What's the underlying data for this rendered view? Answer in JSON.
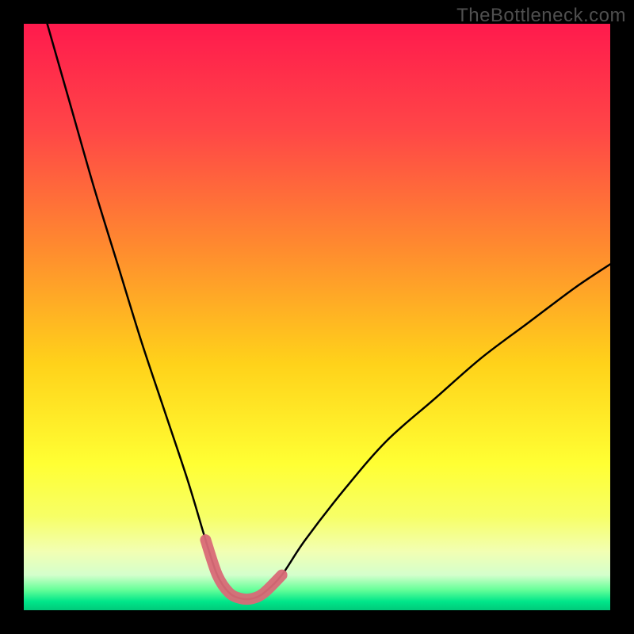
{
  "watermark": "TheBottleneck.com",
  "chart_data": {
    "type": "line",
    "title": "",
    "xlabel": "",
    "ylabel": "",
    "xlim": [
      0,
      100
    ],
    "ylim": [
      0,
      100
    ],
    "series": [
      {
        "name": "bottleneck-curve",
        "x": [
          4,
          8,
          12,
          16,
          20,
          24,
          28,
          31,
          33,
          35,
          37,
          39,
          41,
          44,
          48,
          55,
          62,
          70,
          78,
          86,
          94,
          100
        ],
        "values": [
          100,
          86,
          72,
          59,
          46,
          34,
          22,
          12,
          6,
          3,
          2,
          2,
          3,
          6,
          12,
          21,
          29,
          36,
          43,
          49,
          55,
          59
        ]
      }
    ],
    "highlight_range_x": [
      31,
      44
    ],
    "gradient_stops": [
      {
        "offset": 0.0,
        "color": "#ff1a4d"
      },
      {
        "offset": 0.18,
        "color": "#ff4647"
      },
      {
        "offset": 0.38,
        "color": "#ff8a2f"
      },
      {
        "offset": 0.58,
        "color": "#ffd21a"
      },
      {
        "offset": 0.75,
        "color": "#ffff33"
      },
      {
        "offset": 0.84,
        "color": "#f7ff66"
      },
      {
        "offset": 0.9,
        "color": "#f2ffb3"
      },
      {
        "offset": 0.94,
        "color": "#d4ffcc"
      },
      {
        "offset": 0.965,
        "color": "#66ff99"
      },
      {
        "offset": 0.985,
        "color": "#00e68a"
      },
      {
        "offset": 1.0,
        "color": "#00c97a"
      }
    ]
  }
}
